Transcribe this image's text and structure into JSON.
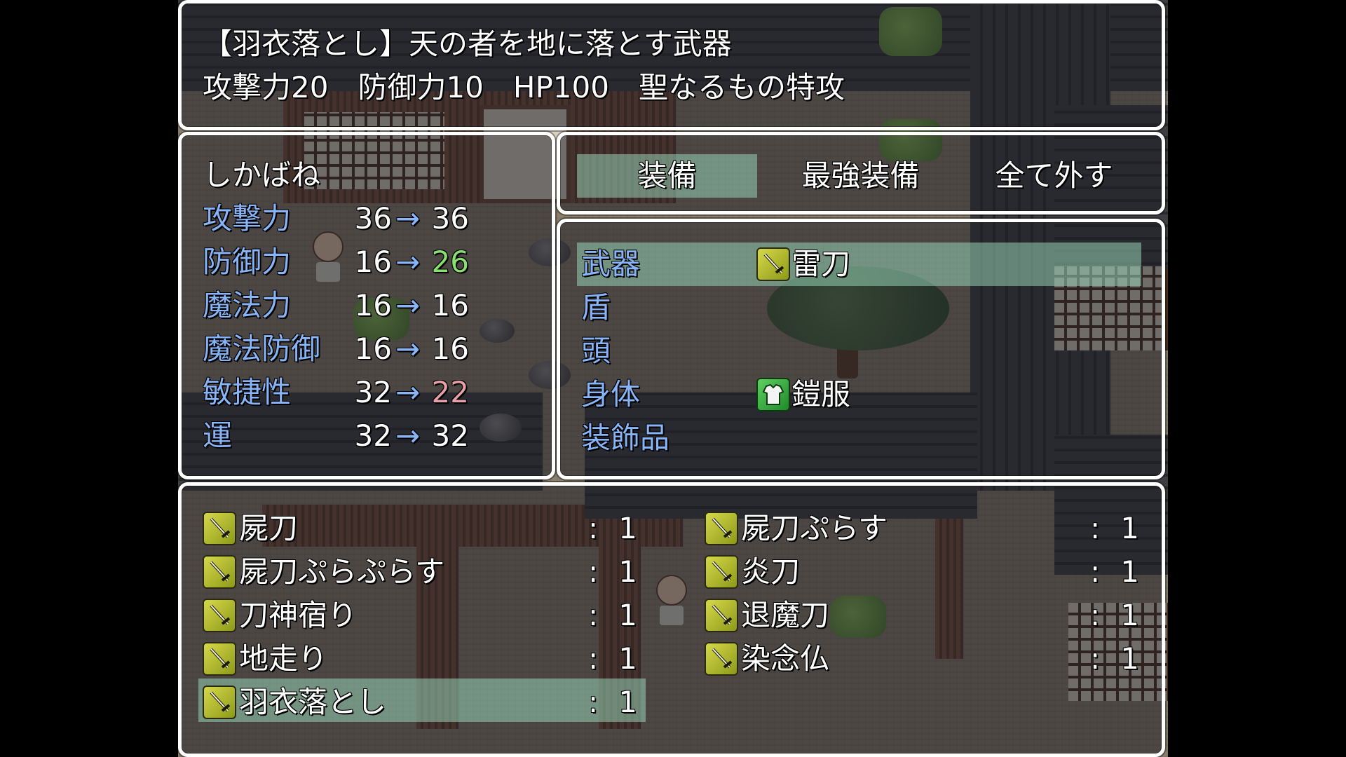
{
  "help": {
    "line1": "【羽衣落とし】天の者を地に落とす武器",
    "line2": "攻撃力20　防御力10　HP100　聖なるもの特攻"
  },
  "status": {
    "actor_name": "しかばね",
    "arrow": "→",
    "params": [
      {
        "label": "攻撃力",
        "current": "36",
        "new": "36",
        "change": "same"
      },
      {
        "label": "防御力",
        "current": "16",
        "new": "26",
        "change": "up"
      },
      {
        "label": "魔法力",
        "current": "16",
        "new": "16",
        "change": "same"
      },
      {
        "label": "魔法防御",
        "current": "16",
        "new": "16",
        "change": "same"
      },
      {
        "label": "敏捷性",
        "current": "32",
        "new": "22",
        "change": "down"
      },
      {
        "label": "運",
        "current": "32",
        "new": "32",
        "change": "same"
      }
    ]
  },
  "commands": {
    "equip": "装備",
    "optimize": "最強装備",
    "clear": "全て外す"
  },
  "slots": [
    {
      "type": "武器",
      "item": "雷刀",
      "icon": "sword-icon"
    },
    {
      "type": "盾",
      "item": "",
      "icon": ""
    },
    {
      "type": "頭",
      "item": "",
      "icon": ""
    },
    {
      "type": "身体",
      "item": "鎧服",
      "icon": "armor-icon"
    },
    {
      "type": "装飾品",
      "item": "",
      "icon": ""
    }
  ],
  "items": {
    "left": [
      {
        "name": "屍刀",
        "count": "1"
      },
      {
        "name": "屍刀ぷらぷらす",
        "count": "1"
      },
      {
        "name": "刀神宿り",
        "count": "1"
      },
      {
        "name": "地走り",
        "count": "1"
      },
      {
        "name": "羽衣落とし",
        "count": "1"
      }
    ],
    "right": [
      {
        "name": "屍刀ぷらす",
        "count": "1"
      },
      {
        "name": "炎刀",
        "count": "1"
      },
      {
        "name": "退魔刀",
        "count": "1"
      },
      {
        "name": "染念仏",
        "count": "1"
      }
    ],
    "separator": ":"
  },
  "colors": {
    "system": "#88b4f8",
    "power_up": "#88e070",
    "power_down": "#e8a0a8",
    "highlight": "#96d2b4"
  }
}
